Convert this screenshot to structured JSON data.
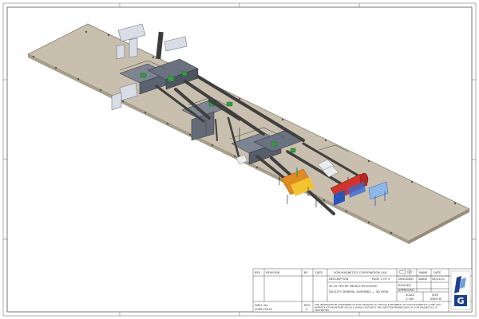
{
  "title_block": {
    "rev_header": "REV",
    "revision_header": "REVISION",
    "by_header": "BY",
    "date_header": "DATE",
    "company": "SGM MAGNETICS CORPORATION USA",
    "page": "PAGE 3 OF 3",
    "description_label": "DESCRIPTION",
    "description": "30-35 TPH NF METALS RECOVERY",
    "facility": "FACILITY GENERAL ASSEMBLY — 3D VIEW",
    "name_header": "NAME",
    "date_col_header": "DATE",
    "designed_label": "DESIGNED",
    "designed_name": "NAIDE",
    "designed_date": "06/10/21",
    "revised_label": "REVISED",
    "approved_label": "APPROVED",
    "scale_label": "SCALE",
    "scale_value": "1:160",
    "size_label": "SIZE",
    "size_value": "ARCH B",
    "dwg_label": "DWG. No.",
    "dwg_value": "20807/0010",
    "rev_label": "REV",
    "rev_value": "0",
    "notice_line1": "THE INFORMATION CONTAINED IN THIS DRAWING IS THE SOLE PROPERTY OF SGM MAGNETICS CORP. ANY",
    "notice_line2": "REPRODUCTION IN PART OR AS A WHOLE WITHOUT THE WRITTEN PERMISSION OF SGM MAGNETICS IS",
    "notice_line3": "PROHIBITED.",
    "logo_letter": "G"
  },
  "colors": {
    "floor": "#c9bfae",
    "floor_edge": "#8c8272",
    "conveyor": "#3f3f3f",
    "accent_green": "#2f9e3f",
    "accent_red": "#d0342c",
    "accent_orange": "#e08a22",
    "accent_blue": "#2b55b8"
  }
}
